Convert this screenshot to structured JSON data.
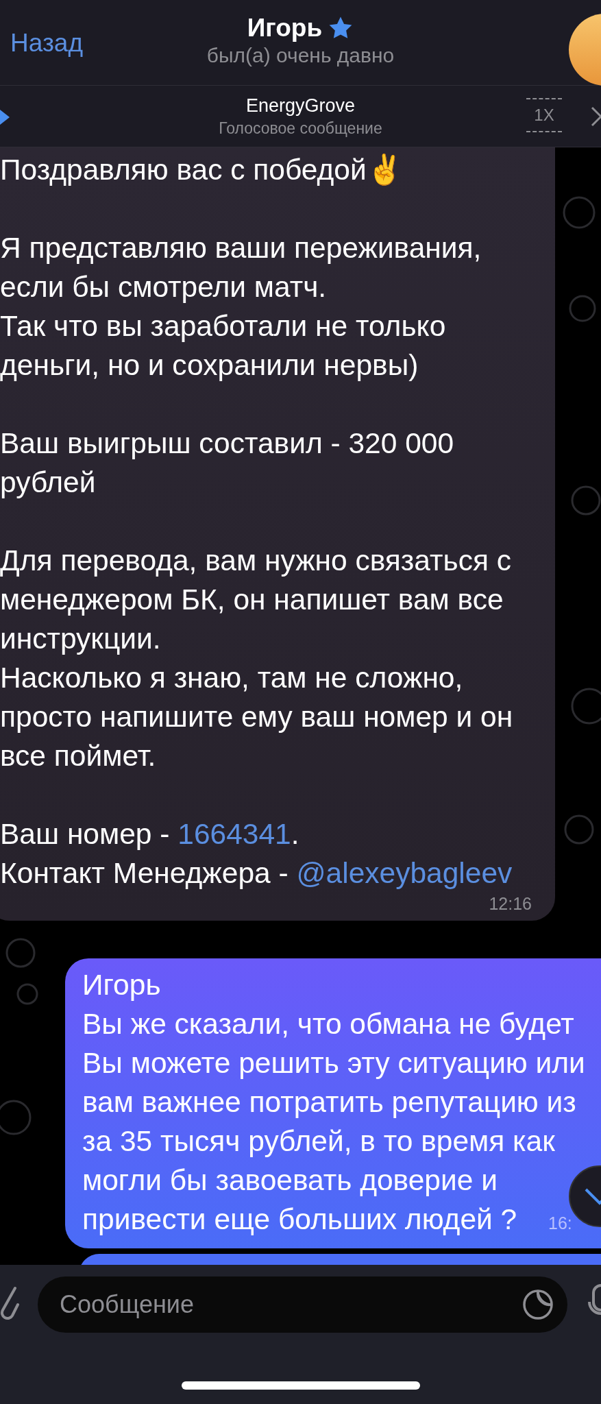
{
  "header": {
    "back": "Назад",
    "title": "Игорь",
    "subtitle": "был(а) очень давно"
  },
  "player": {
    "title": "EnergyGrove",
    "subtitle": "Голосовое сообщение",
    "speed": "1X"
  },
  "messages": [
    {
      "kind": "incoming",
      "parts": [
        {
          "text": "Поздравляю вас с победой✌\n\nЯ представляю ваши переживания,\nесли бы смотрели матч.\nТак что вы заработали не только\nденьги, но и сохранили нервы)\n\nВаш выигрыш составил - 320 000\nрублей\n\nДля перевода, вам нужно связаться с\nменеджером БК, он напишет вам все\nинструкции.\nНасколько я знаю, там не сложно,\nпросто напишите ему ваш номер и он\nвсе поймет.\n\nВаш номер - ",
          "link": false
        },
        {
          "text": "1664341",
          "link": true
        },
        {
          "text": ".\nКонтакт Менеджера - ",
          "link": false
        },
        {
          "text": "@alexeybagleev",
          "link": true
        }
      ],
      "time": "12:16"
    },
    {
      "kind": "outgoing",
      "parts": [
        {
          "text": "Игорь\nВы же сказали, что обмана не будет\nВы можете решить эту ситуацию или\nвам важнее потратить репутацию из\nза 35 тысяч рублей, в то время как\nмогли бы завоевать доверие и\nпривести еще больших людей ?",
          "link": false
        }
      ],
      "time": "16:"
    },
    {
      "kind": "outgoing"
    }
  ],
  "composer": {
    "placeholder": "Сообщение"
  }
}
